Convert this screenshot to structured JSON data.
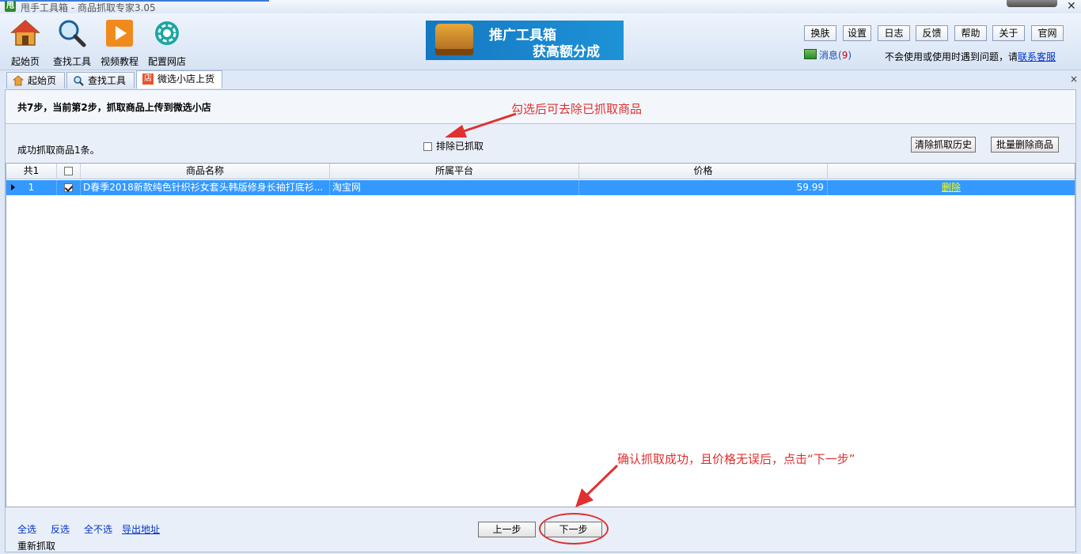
{
  "window": {
    "title": "甩手工具箱 - 商品抓取专家3.05",
    "app_icon_text": "甩",
    "close_glyph": "✕"
  },
  "toolbar": {
    "items": [
      {
        "label": "起始页",
        "icon": "home-icon"
      },
      {
        "label": "查找工具",
        "icon": "magnifier-icon"
      },
      {
        "label": "视频教程",
        "icon": "play-icon"
      },
      {
        "label": "配置网店",
        "icon": "gear-icon"
      }
    ],
    "banner": {
      "line1": "推广工具箱",
      "line2": "获高额分成"
    },
    "buttons": [
      "换肤",
      "设置",
      "日志",
      "反馈",
      "帮助",
      "关于",
      "官网"
    ],
    "messages": {
      "label": "消息(",
      "count": "9",
      "suffix": ")"
    },
    "help_text": "不会使用或使用时遇到问题，请",
    "support_link": "联系客服"
  },
  "tabs": [
    {
      "label": "起始页",
      "icon": "home-icon"
    },
    {
      "label": "查找工具",
      "icon": "magnifier-icon"
    },
    {
      "label": "微选小店上货",
      "icon": "shop-icon",
      "icon_text": "店",
      "active": true
    }
  ],
  "tab_close": "×",
  "step": {
    "title": "共7步，当前第2步，抓取商品上传到微选小店"
  },
  "annotations": {
    "exclude_tip": "勾选后可去除已抓取商品",
    "next_tip": "确认抓取成功，且价格无误后，点击“下一步”"
  },
  "summary": {
    "success_text": "成功抓取商品1条。"
  },
  "exclude_checkbox": {
    "label": "排除已抓取",
    "checked": false
  },
  "actions": {
    "clear_history": "清除抓取历史",
    "batch_delete": "批量删除商品"
  },
  "grid": {
    "columns": {
      "count": "共1",
      "name": "商品名称",
      "platform": "所属平台",
      "price": "价格",
      "op": ""
    },
    "rows": [
      {
        "index": "1",
        "checked": true,
        "name": "D春季2018新款纯色针织衫女套头韩版修身长袖打底衫...",
        "platform": "淘宝网",
        "price": "59.99",
        "action": "删除"
      }
    ]
  },
  "bottom": {
    "select_all": "全选",
    "invert": "反选",
    "select_none": "全不选",
    "export": "导出地址",
    "recrawl": "重新抓取",
    "prev": "上一步",
    "next": "下一步"
  },
  "colors": {
    "accent": "#3399ff",
    "annotation": "#e03030",
    "link": "#0033cc"
  }
}
